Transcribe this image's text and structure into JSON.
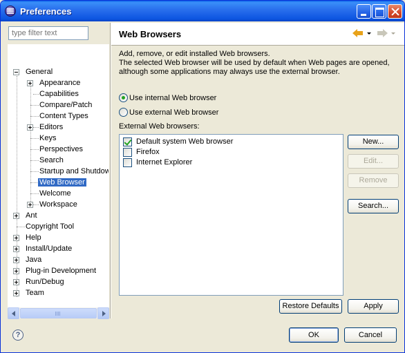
{
  "window": {
    "title": "Preferences"
  },
  "filter": {
    "placeholder": "type filter text"
  },
  "tree": {
    "general": "General",
    "appearance": "Appearance",
    "capabilities": "Capabilities",
    "compare_patch": "Compare/Patch",
    "content_types": "Content Types",
    "editors": "Editors",
    "keys": "Keys",
    "perspectives": "Perspectives",
    "search": "Search",
    "startup": "Startup and Shutdow",
    "web_browser": "Web Browser",
    "welcome": "Welcome",
    "workspace": "Workspace",
    "ant": "Ant",
    "copyright": "Copyright Tool",
    "help": "Help",
    "install_update": "Install/Update",
    "java": "Java",
    "plugin_dev": "Plug-in Development",
    "run_debug": "Run/Debug",
    "team": "Team"
  },
  "page": {
    "title": "Web Browsers",
    "desc_line1": "Add, remove, or edit installed Web browsers.",
    "desc_line2": "The selected Web browser will be used by default when Web pages are opened,",
    "desc_line3": "although some applications may always use the external browser.",
    "radio_internal": "Use internal Web browser",
    "radio_external": "Use external Web browser",
    "selected_radio": "internal",
    "external_label": "External Web browsers:",
    "browsers": [
      {
        "label": "Default system Web browser",
        "checked": true
      },
      {
        "label": "Firefox",
        "checked": false
      },
      {
        "label": "Internet Explorer",
        "checked": false
      }
    ],
    "buttons": {
      "new": "New...",
      "edit": "Edit...",
      "remove": "Remove",
      "search": "Search...",
      "restore_defaults": "Restore Defaults",
      "apply": "Apply"
    }
  },
  "footer": {
    "help_glyph": "?",
    "ok": "OK",
    "cancel": "Cancel"
  },
  "colors": {
    "titlebar": "#0a5fe8",
    "selection": "#316ac5",
    "window_bg": "#ece9d8"
  }
}
